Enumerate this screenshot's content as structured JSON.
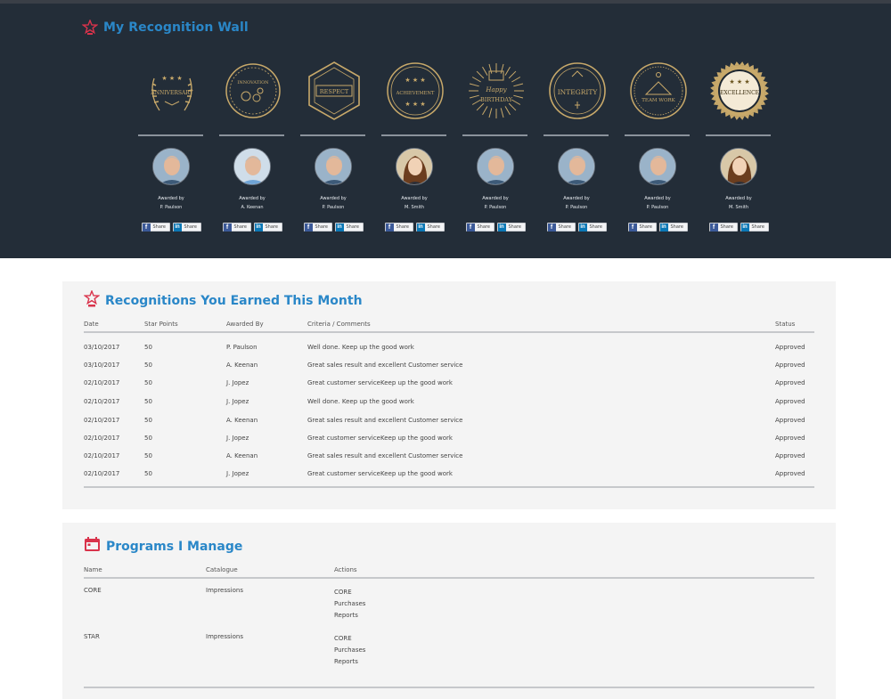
{
  "wall": {
    "title": "My Recognition Wall",
    "awarded_by_label": "Awarded by",
    "share": {
      "facebook": "Share",
      "linkedin": "Share"
    },
    "badges": [
      {
        "name": "ANNIVERSARY",
        "icon": "anniversary-laurel-badge-icon",
        "awarded_by": "Awarded by",
        "name_giver": "P. Paulson",
        "avatar": "man"
      },
      {
        "name": "INNOVATION",
        "icon": "innovation-gear-badge-icon",
        "awarded_by": "Awarded by",
        "name_giver": "A. Keenan",
        "avatar": "man-blue"
      },
      {
        "name": "RESPECT",
        "icon": "respect-hexagon-badge-icon",
        "awarded_by": "Awarded by",
        "name_giver": "P. Paulson",
        "avatar": "man"
      },
      {
        "name": "ACHIEVEMENT",
        "icon": "achievement-stars-badge-icon",
        "awarded_by": "Awarded by",
        "name_giver": "M. Smith",
        "avatar": "woman"
      },
      {
        "name": "Happy BIRTHDAY",
        "icon": "birthday-sunburst-badge-icon",
        "awarded_by": "Awarded by",
        "name_giver": "P. Paulson",
        "avatar": "man"
      },
      {
        "name": "INTEGRITY",
        "icon": "integrity-seal-badge-icon",
        "awarded_by": "Awarded by",
        "name_giver": "P. Paulson",
        "avatar": "man"
      },
      {
        "name": "TEAM WORK",
        "icon": "teamwork-emblem-badge-icon",
        "awarded_by": "Awarded by",
        "name_giver": "P. Paulson",
        "avatar": "man"
      },
      {
        "name": "EXCELLENCE",
        "icon": "excellence-gold-seal-badge-icon",
        "awarded_by": "Awarded by",
        "name_giver": "M. Smith",
        "avatar": "woman"
      }
    ]
  },
  "earned": {
    "title": "Recognitions You Earned This Month",
    "columns": {
      "date": "Date",
      "points": "Star Points",
      "awarded_by": "Awarded By",
      "criteria": "Criteria / Comments",
      "status": "Status"
    },
    "rows": [
      {
        "date": "03/10/2017",
        "points": "50",
        "by": "P. Paulson",
        "comment": "Well done. Keep up the good work",
        "status": "Approved"
      },
      {
        "date": "03/10/2017",
        "points": "50",
        "by": "A. Keenan",
        "comment": "Great sales result  and excellent Customer service",
        "status": "Approved"
      },
      {
        "date": "02/10/2017",
        "points": "50",
        "by": "J. Jopez",
        "comment": "Great customer serviceKeep up the good work",
        "status": "Approved"
      },
      {
        "date": "02/10/2017",
        "points": "50",
        "by": "J. Jopez",
        "comment": "Well done. Keep up the good work",
        "status": "Approved"
      },
      {
        "date": "02/10/2017",
        "points": "50",
        "by": "A. Keenan",
        "comment": "Great sales result  and excellent Customer service",
        "status": "Approved"
      },
      {
        "date": "02/10/2017",
        "points": "50",
        "by": "J. Jopez",
        "comment": "Great customer serviceKeep up the good work",
        "status": "Approved"
      },
      {
        "date": "02/10/2017",
        "points": "50",
        "by": "A. Keenan",
        "comment": "Great sales result  and excellent Customer service",
        "status": "Approved"
      },
      {
        "date": "02/10/2017",
        "points": "50",
        "by": "J. Jopez",
        "comment": "Great customer serviceKeep up the good work",
        "status": "Approved"
      }
    ]
  },
  "programs": {
    "title": "Programs I Manage",
    "columns": {
      "name": "Name",
      "catalogue": "Catalogue",
      "actions": "Actions"
    },
    "rows": [
      {
        "name": "CORE",
        "catalogue": "Impressions",
        "actions": [
          "CORE",
          "Purchases",
          "Reports"
        ]
      },
      {
        "name": "STAR",
        "catalogue": "Impressions",
        "actions": [
          "CORE",
          "Purchases",
          "Reports"
        ]
      }
    ]
  },
  "colors": {
    "wall_bg": "#232d38",
    "accent_blue": "#2a87c8",
    "icon_red": "#d9334b",
    "badge_gold": "#c8a96a",
    "panel_bg": "#f4f4f4"
  }
}
